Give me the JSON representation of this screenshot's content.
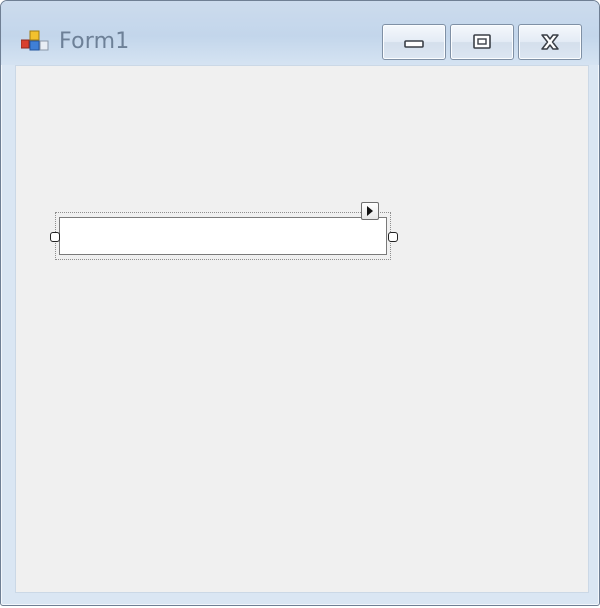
{
  "window": {
    "title": "Form1",
    "icon": "windows-form-icon",
    "caption_buttons": {
      "minimize_icon": "minimize-icon",
      "maximize_icon": "maximize-icon",
      "close_icon": "close-icon"
    }
  },
  "designer": {
    "textbox_value": "",
    "smart_tag_icon": "smart-tag-arrow-icon"
  },
  "colors": {
    "titlebar": "#c3d6eb",
    "client_background": "#f0f0f0",
    "title_text": "#6d8097"
  }
}
